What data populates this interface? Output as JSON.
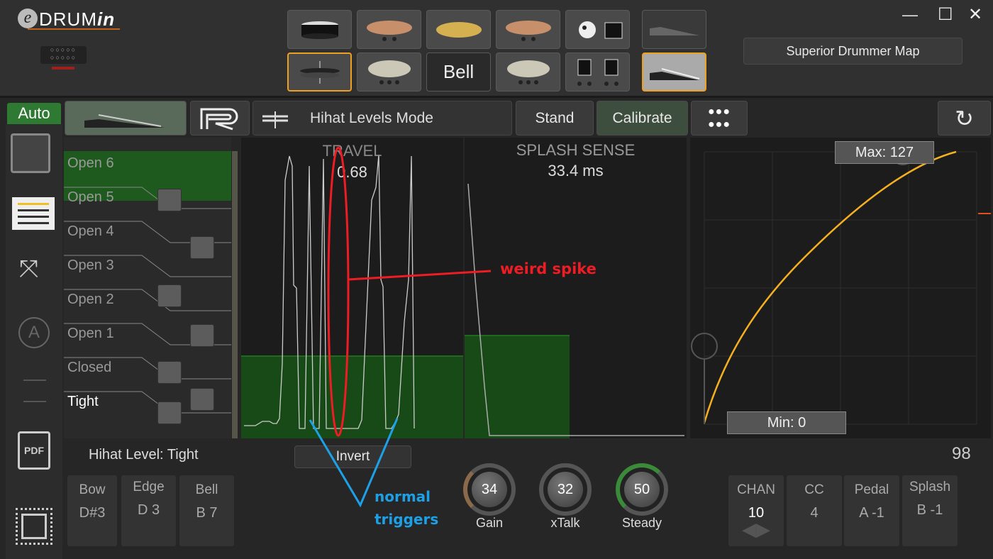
{
  "app": {
    "logo": "eDRUMin"
  },
  "window": {
    "minimize": "—",
    "maximize": "☐",
    "close": "✕"
  },
  "header": {
    "pad_bell_label": "Bell",
    "map_button": "Superior Drummer Map"
  },
  "toolbar": {
    "auto": "Auto",
    "mode": "Hihat Levels Mode",
    "stand": "Stand",
    "calibrate": "Calibrate"
  },
  "levels": [
    "Open 6",
    "Open 5",
    "Open 4",
    "Open 3",
    "Open 2",
    "Open 1",
    "Closed",
    "Tight"
  ],
  "travel": {
    "title": "TRAVEL",
    "value": "0.68"
  },
  "splash": {
    "title": "SPLASH SENSE",
    "value": "33.4 ms"
  },
  "curve": {
    "max": "Max: 127",
    "min": "Min: 0"
  },
  "bottom": {
    "hihat_level": "Hihat Level: Tight",
    "invert": "Invert",
    "value_readout": "98",
    "notes": [
      {
        "label": "Bow",
        "value": "D#3"
      },
      {
        "label": "Edge",
        "value": "D 3"
      },
      {
        "label": "Bell",
        "value": "B 7"
      }
    ],
    "knobs": [
      {
        "label": "Gain",
        "value": "34",
        "color": "#8a6a4a"
      },
      {
        "label": "xTalk",
        "value": "32",
        "color": "#555555"
      },
      {
        "label": "Steady",
        "value": "50",
        "color": "#3a8a3a"
      }
    ],
    "midi": [
      {
        "label": "CHAN",
        "value": "10"
      },
      {
        "label": "CC",
        "value": "4"
      },
      {
        "label": "Pedal",
        "value": "A -1"
      },
      {
        "label": "Splash",
        "value": "B -1"
      }
    ]
  },
  "annotations": {
    "spike": "weird spike",
    "normal_line1": "normal",
    "normal_line2": "triggers",
    "red": "#ee1c24",
    "blue": "#1ea0e6"
  },
  "colors": {
    "accent_orange": "#f0a020",
    "green": "#2a7a2a",
    "curve": "#f5b020"
  }
}
